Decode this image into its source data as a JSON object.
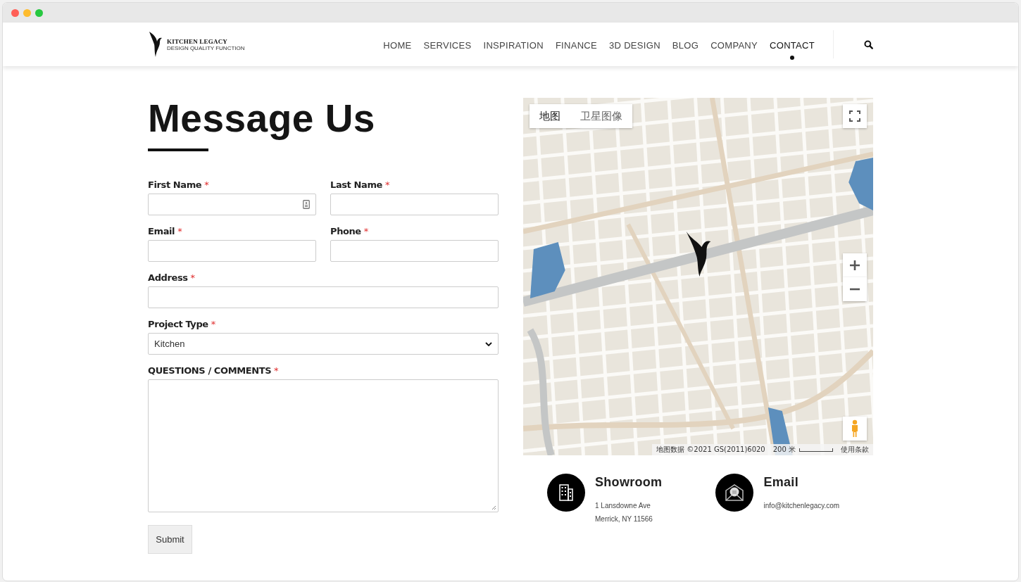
{
  "browser": {
    "lights": [
      {
        "color": "#ff5f57"
      },
      {
        "color": "#febc2e"
      },
      {
        "color": "#28c840"
      }
    ]
  },
  "header": {
    "logo": {
      "name": "KITCHEN LEGACY",
      "tagline": "DESIGN QUALITY FUNCTION"
    },
    "nav": [
      {
        "label": "HOME",
        "selected": false
      },
      {
        "label": "SERVICES",
        "selected": false
      },
      {
        "label": "INSPIRATION",
        "selected": false
      },
      {
        "label": "FINANCE",
        "selected": false
      },
      {
        "label": "3D DESIGN",
        "selected": false
      },
      {
        "label": "BLOG",
        "selected": false
      },
      {
        "label": "COMPANY",
        "selected": false
      },
      {
        "label": "CONTACT",
        "selected": true
      }
    ]
  },
  "form": {
    "title": "Message Us",
    "rows": [
      {
        "fields": [
          {
            "kind": "text",
            "label": "First Name",
            "required_mark": "*",
            "autofill_icon": true
          },
          {
            "kind": "text",
            "label": "Last Name",
            "required_mark": "*",
            "autofill_icon": false
          }
        ]
      },
      {
        "fields": [
          {
            "kind": "text",
            "label": "Email",
            "required_mark": "*",
            "autofill_icon": false
          },
          {
            "kind": "text",
            "label": "Phone",
            "required_mark": "*",
            "autofill_icon": false
          }
        ]
      },
      {
        "fields": [
          {
            "kind": "text",
            "label": "Address",
            "required_mark": "*",
            "autofill_icon": false
          }
        ]
      },
      {
        "fields": [
          {
            "kind": "select",
            "label": "Project Type",
            "required_mark": "*",
            "value": "Kitchen"
          }
        ]
      },
      {
        "fields": [
          {
            "kind": "textarea",
            "label": "QUESTIONS / COMMENTS",
            "required_mark": "*"
          }
        ]
      }
    ],
    "submit": "Submit"
  },
  "map": {
    "types": [
      {
        "label": "地图",
        "selected": true
      },
      {
        "label": "卫星图像",
        "selected": false
      }
    ],
    "attribution": "地图数据 ©2021 GS(2011)6020",
    "scale": "200 米",
    "terms": "使用条款"
  },
  "contacts": [
    {
      "kind": "building",
      "title": "Showroom",
      "lines": [
        "1 Lansdowne Ave",
        "Merrick, NY 11566"
      ]
    },
    {
      "kind": "mail",
      "title": "Email",
      "lines": [
        "info@kitchenlegacy.com"
      ]
    }
  ]
}
